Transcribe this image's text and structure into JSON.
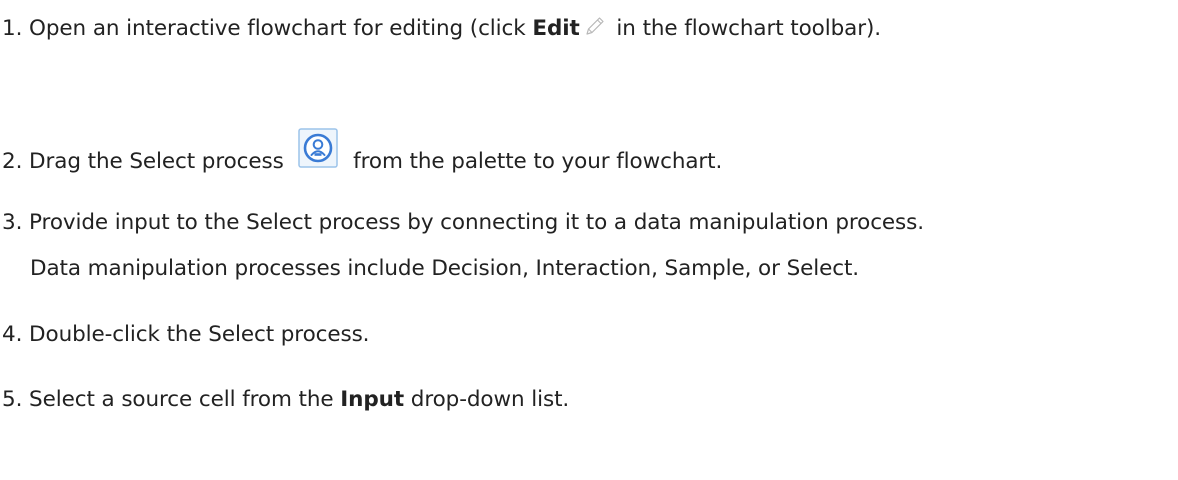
{
  "steps": [
    {
      "number": "1.",
      "before": " Open an interactive flowchart for editing (click ",
      "bold": "Edit",
      "icon": "pencil-icon",
      "after": " in the flowchart toolbar)."
    },
    {
      "number": "2.",
      "before": " Drag the Select process ",
      "icon": "select-process-icon",
      "after": " from the palette to your flowchart."
    },
    {
      "number": "3.",
      "text": " Provide input to the Select process by connecting it to a data manipulation process.",
      "note": "Data manipulation processes include Decision, Interaction, Sample, or Select."
    },
    {
      "number": "4.",
      "text": " Double-click the Select process."
    },
    {
      "number": "5.",
      "before": " Select a source cell from the ",
      "bold": "Input",
      "after": " drop-down list."
    }
  ],
  "colors": {
    "text": "#222222",
    "icon_blue": "#3a7bd5",
    "icon_border": "#9cc3ea",
    "pencil_gray": "#b8b8b8"
  }
}
